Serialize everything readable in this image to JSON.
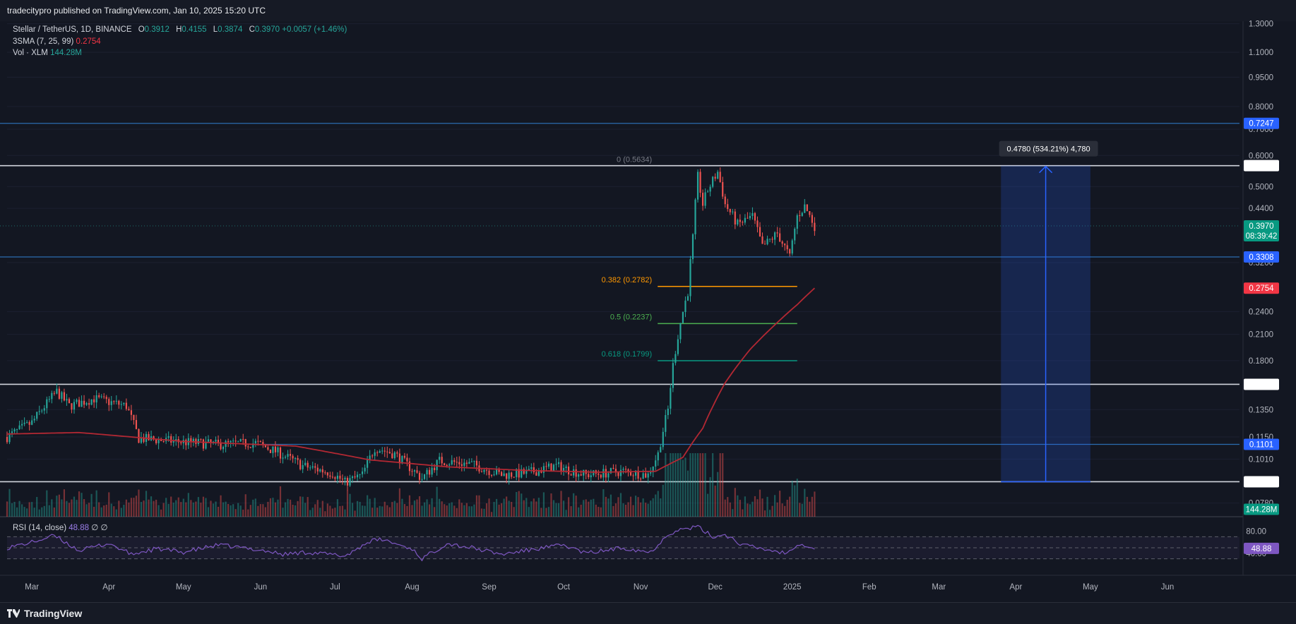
{
  "header": {
    "published": "tradecitypro published on TradingView.com, Jan 10, 2025 15:20 UTC"
  },
  "legend": {
    "symbol": "Stellar / TetherUS, 1D, BINANCE",
    "open_label": "O",
    "open": "0.3912",
    "high_label": "H",
    "high": "0.4155",
    "low_label": "L",
    "low": "0.3874",
    "close_label": "C",
    "close": "0.3970",
    "change": "+0.0057 (+1.46%)",
    "sma_label": "3SMA (7, 25, 99)",
    "sma_value": "0.2754",
    "vol_label": "Vol · XLM",
    "vol_value": "144.28M"
  },
  "rsi_legend": {
    "label": "RSI (14, close)",
    "value": "48.88",
    "extra": "∅ ∅"
  },
  "footer": {
    "brand": "TradingView"
  },
  "colors": {
    "background": "#131722",
    "up": "#26a69a",
    "down": "#ef5350",
    "sma": "#b22833",
    "rsi": "#7e57c2",
    "level_blue": "#2962ff",
    "level_white": "#ffffff"
  },
  "chart_data": {
    "type": "candlestick",
    "symbol": "XLM/USDT",
    "interval": "1D",
    "scale": "log",
    "x_range": [
      "2024-02-20",
      "2025-06-30"
    ],
    "y_range": [
      0.072,
      1.32
    ],
    "price_ticks": [
      "1.3000",
      "1.1000",
      "0.9500",
      "0.8000",
      "0.7000",
      "0.6000",
      "0.5000",
      "0.4400",
      "0.3200",
      "0.2400",
      "0.2100",
      "0.1800",
      "0.1350",
      "0.1150",
      "0.1010",
      "0.0780"
    ],
    "time_labels": [
      "Mar",
      "Apr",
      "May",
      "Jun",
      "Jul",
      "Aug",
      "Sep",
      "Oct",
      "Nov",
      "Dec",
      "2025",
      "Feb",
      "Mar",
      "Apr",
      "May",
      "Jun"
    ],
    "price_anchors": [
      [
        "2024-02-20",
        0.115
      ],
      [
        "2024-03-01",
        0.125
      ],
      [
        "2024-03-11",
        0.15
      ],
      [
        "2024-03-16",
        0.138
      ],
      [
        "2024-03-26",
        0.144
      ],
      [
        "2024-04-08",
        0.138
      ],
      [
        "2024-04-13",
        0.114
      ],
      [
        "2024-04-28",
        0.112
      ],
      [
        "2024-05-15",
        0.11
      ],
      [
        "2024-05-30",
        0.111
      ],
      [
        "2024-06-08",
        0.105
      ],
      [
        "2024-06-18",
        0.097
      ],
      [
        "2024-06-30",
        0.093
      ],
      [
        "2024-07-05",
        0.088
      ],
      [
        "2024-07-12",
        0.092
      ],
      [
        "2024-07-17",
        0.108
      ],
      [
        "2024-07-25",
        0.104
      ],
      [
        "2024-08-05",
        0.09
      ],
      [
        "2024-08-12",
        0.1
      ],
      [
        "2024-08-25",
        0.098
      ],
      [
        "2024-09-06",
        0.092
      ],
      [
        "2024-09-16",
        0.093
      ],
      [
        "2024-09-28",
        0.097
      ],
      [
        "2024-10-10",
        0.092
      ],
      [
        "2024-10-25",
        0.094
      ],
      [
        "2024-11-04",
        0.092
      ],
      [
        "2024-11-08",
        0.104
      ],
      [
        "2024-11-12",
        0.135
      ],
      [
        "2024-11-14",
        0.175
      ],
      [
        "2024-11-17",
        0.225
      ],
      [
        "2024-11-20",
        0.27
      ],
      [
        "2024-11-22",
        0.37
      ],
      [
        "2024-11-24",
        0.53
      ],
      [
        "2024-11-26",
        0.45
      ],
      [
        "2024-11-28",
        0.49
      ],
      [
        "2024-12-02",
        0.545
      ],
      [
        "2024-12-05",
        0.45
      ],
      [
        "2024-12-10",
        0.4
      ],
      [
        "2024-12-16",
        0.42
      ],
      [
        "2024-12-20",
        0.35
      ],
      [
        "2024-12-26",
        0.38
      ],
      [
        "2024-12-31",
        0.33
      ],
      [
        "2025-01-03",
        0.42
      ],
      [
        "2025-01-06",
        0.445
      ],
      [
        "2025-01-10",
        0.397
      ]
    ],
    "sma_99_anchors": [
      [
        "2024-02-20",
        0.117
      ],
      [
        "2024-03-20",
        0.118
      ],
      [
        "2024-05-01",
        0.112
      ],
      [
        "2024-06-15",
        0.109
      ],
      [
        "2024-07-15",
        0.1005
      ],
      [
        "2024-08-15",
        0.0965
      ],
      [
        "2024-09-15",
        0.0945
      ],
      [
        "2024-10-15",
        0.0935
      ],
      [
        "2024-11-07",
        0.094
      ],
      [
        "2024-11-18",
        0.102
      ],
      [
        "2024-11-26",
        0.121
      ],
      [
        "2024-12-05",
        0.158
      ],
      [
        "2024-12-15",
        0.192
      ],
      [
        "2024-12-25",
        0.222
      ],
      [
        "2025-01-03",
        0.25
      ],
      [
        "2025-01-10",
        0.2754
      ]
    ],
    "volume_last": "144.28M",
    "rsi": {
      "period": 14,
      "last": 48.88,
      "levels": [
        70,
        50,
        30
      ],
      "axis_labels": [
        "80.00",
        "40.00"
      ],
      "anchors": [
        [
          "2024-02-20",
          50
        ],
        [
          "2024-03-01",
          60
        ],
        [
          "2024-03-10",
          72
        ],
        [
          "2024-03-20",
          45
        ],
        [
          "2024-04-01",
          58
        ],
        [
          "2024-04-10",
          38
        ],
        [
          "2024-04-20",
          48
        ],
        [
          "2024-05-01",
          42
        ],
        [
          "2024-05-15",
          55
        ],
        [
          "2024-06-01",
          46
        ],
        [
          "2024-06-10",
          38
        ],
        [
          "2024-06-20",
          42
        ],
        [
          "2024-07-05",
          35
        ],
        [
          "2024-07-15",
          62
        ],
        [
          "2024-07-20",
          65
        ],
        [
          "2024-08-01",
          48
        ],
        [
          "2024-08-05",
          30
        ],
        [
          "2024-08-15",
          58
        ],
        [
          "2024-08-25",
          50
        ],
        [
          "2024-09-06",
          38
        ],
        [
          "2024-09-20",
          48
        ],
        [
          "2024-10-01",
          55
        ],
        [
          "2024-10-10",
          40
        ],
        [
          "2024-10-25",
          50
        ],
        [
          "2024-11-05",
          42
        ],
        [
          "2024-11-12",
          75
        ],
        [
          "2024-11-16",
          82
        ],
        [
          "2024-11-24",
          88
        ],
        [
          "2024-11-30",
          70
        ],
        [
          "2024-12-05",
          74
        ],
        [
          "2024-12-12",
          55
        ],
        [
          "2024-12-20",
          48
        ],
        [
          "2024-12-30",
          40
        ],
        [
          "2025-01-03",
          58
        ],
        [
          "2025-01-07",
          54
        ],
        [
          "2025-01-10",
          48.88
        ]
      ]
    },
    "horizontal_levels": [
      {
        "price": 0.7247,
        "label": "0.7247",
        "color": "#2962ff"
      },
      {
        "price": 0.5653,
        "label": "0.5653",
        "color": "#ffffff"
      },
      {
        "price": 0.3308,
        "label": "0.3308",
        "color": "#2962ff"
      },
      {
        "price": 0.1566,
        "label": "0.1566",
        "color": "#ffffff"
      },
      {
        "price": 0.1101,
        "label": "0.1101",
        "color": "#2962ff"
      },
      {
        "price": 0.0884,
        "label": "0.0884",
        "color": "#ffffff"
      }
    ],
    "price_tags": [
      {
        "price": 0.397,
        "label": "0.3970",
        "sub": "08:39:42",
        "color": "#089981"
      },
      {
        "price": 0.2754,
        "label": "0.2754",
        "color": "#f23645"
      },
      {
        "price": 0.0752,
        "label": "144.28M",
        "color": "#089981"
      }
    ],
    "fib_levels": [
      {
        "ratio": "0",
        "price": 0.5634,
        "label": "0 (0.5634)",
        "color": "#787b86"
      },
      {
        "ratio": "0.382",
        "price": 0.2782,
        "label": "0.382 (0.2782)",
        "color": "#ff9800"
      },
      {
        "ratio": "0.5",
        "price": 0.2237,
        "label": "0.5 (0.2237)",
        "color": "#4caf50"
      },
      {
        "ratio": "0.618",
        "price": 0.1799,
        "label": "0.618 (0.1799)",
        "color": "#089981"
      }
    ],
    "fib_range": [
      "2024-11-05",
      "2025-01-03"
    ],
    "measure": {
      "from_price": 0.0884,
      "to_price": 0.5653,
      "from_date": "2025-03-26",
      "to_date": "2025-05-01",
      "label": "0.4780 (534.21%) 4,780"
    }
  }
}
